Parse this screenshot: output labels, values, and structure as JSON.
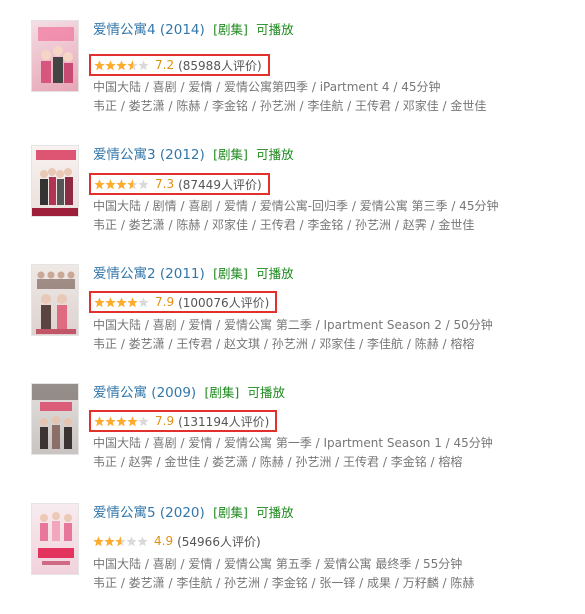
{
  "colors": {
    "link": "#3377aa",
    "tag": "#1e8a1e",
    "star": "#ffac2d",
    "score": "#e09015",
    "highlight": "#e2302d"
  },
  "items": [
    {
      "title": "爱情公寓4",
      "year": "(2014)",
      "tag1": "[剧集]",
      "tag2": "可播放",
      "stars": 3.5,
      "score": "7.2",
      "count": "(85988人评价)",
      "boxed": true,
      "meta1": "中国大陆 / 喜剧 / 爱情 / 爱情公寓第四季 / iPartment 4 / 45分钟",
      "meta2": "韦正 / 娄艺潇 / 陈赫 / 李金铭 / 孙艺洲 / 李佳航 / 王传君 / 邓家佳 / 金世佳"
    },
    {
      "title": "爱情公寓3",
      "year": "(2012)",
      "tag1": "[剧集]",
      "tag2": "可播放",
      "stars": 3.5,
      "score": "7.3",
      "count": "(87449人评价)",
      "boxed": true,
      "meta1": "中国大陆 / 剧情 / 喜剧 / 爱情 / 爱情公寓-回归季 / 爱情公寓 第三季 / 45分钟",
      "meta2": "韦正 / 娄艺潇 / 陈赫 / 邓家佳 / 王传君 / 李金铭 / 孙艺洲 / 赵霁 / 金世佳"
    },
    {
      "title": "爱情公寓2",
      "year": "(2011)",
      "tag1": "[剧集]",
      "tag2": "可播放",
      "stars": 4,
      "score": "7.9",
      "count": "(100076人评价)",
      "boxed": true,
      "meta1": "中国大陆 / 喜剧 / 爱情 / 爱情公寓 第二季 / Ipartment Season 2 / 50分钟",
      "meta2": "韦正 / 娄艺潇 / 王传君 / 赵文琪 / 孙艺洲 / 邓家佳 / 李佳航 / 陈赫 / 榕榕"
    },
    {
      "title": "爱情公寓",
      "year": "(2009)",
      "tag1": "[剧集]",
      "tag2": "可播放",
      "stars": 4,
      "score": "7.9",
      "count": "(131194人评价)",
      "boxed": true,
      "meta1": "中国大陆 / 喜剧 / 爱情 / 爱情公寓 第一季 / Ipartment Season 1 / 45分钟",
      "meta2": "韦正 / 赵霁 / 金世佳 / 娄艺潇 / 陈赫 / 孙艺洲 / 王传君 / 李金铭 / 榕榕"
    },
    {
      "title": "爱情公寓5",
      "year": "(2020)",
      "tag1": "[剧集]",
      "tag2": "可播放",
      "stars": 2.5,
      "score": "4.9",
      "count": "(54966人评价)",
      "boxed": false,
      "meta1": "中国大陆 / 喜剧 / 爱情 / 爱情公寓 第五季 / 爱情公寓 最终季 / 55分钟",
      "meta2": "韦正 / 娄艺潇 / 李佳航 / 孙艺洲 / 李金铭 / 张一铎 / 成果 / 万籽麟 / 陈赫"
    }
  ]
}
